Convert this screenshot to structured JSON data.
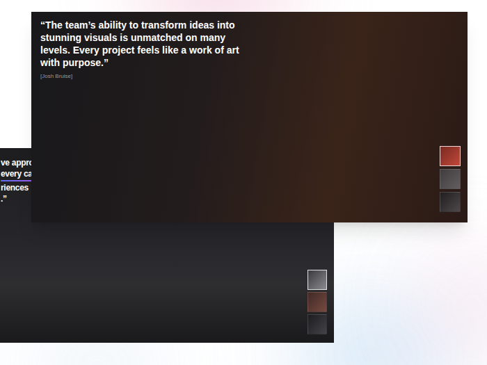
{
  "testimonials": [
    {
      "quote_fragments": [
        "ve appro",
        "every ca",
        "riences",
        ".”"
      ],
      "thumbnails": [
        {
          "selected": true
        },
        {
          "selected": false
        },
        {
          "selected": false
        }
      ]
    },
    {
      "quote": "“The team’s ability to transform ideas into stunning visuals is unmatched on many levels. Every project feels like a work of art with purpose.”",
      "author": "[Josh Bruise]",
      "thumbnails": [
        {
          "selected": true
        },
        {
          "selected": false
        },
        {
          "selected": false
        }
      ]
    }
  ]
}
